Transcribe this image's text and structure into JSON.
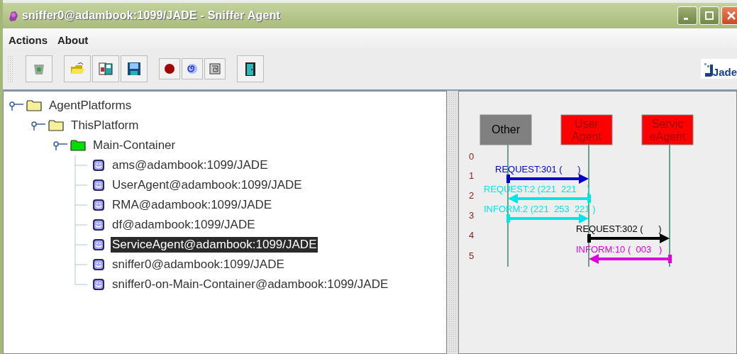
{
  "window": {
    "title": "sniffer0@adambook:1099/JADE - Sniffer Agent"
  },
  "menu": [
    "Actions",
    "About"
  ],
  "toolbar": [
    [
      {
        "kind": "trash"
      }
    ],
    [
      {
        "kind": "open-folder"
      },
      {
        "kind": "document-disk"
      },
      {
        "kind": "floppy"
      }
    ],
    [
      {
        "kind": "record"
      },
      {
        "kind": "spiral"
      },
      {
        "kind": "square-spiral"
      }
    ],
    [
      {
        "kind": "door"
      }
    ]
  ],
  "logo": "Jade",
  "tree": [
    {
      "label": "AgentPlatforms",
      "kind": "folder",
      "color": "#f5f09a",
      "expanded": true,
      "selected": false,
      "children": [
        {
          "label": "ThisPlatform",
          "kind": "folder",
          "color": "#f5f09a",
          "expanded": true,
          "selected": false,
          "children": [
            {
              "label": "Main-Container",
              "kind": "folder",
              "color": "#00dd00",
              "expanded": true,
              "selected": false,
              "children": [
                {
                  "label": "ams@adambook:1099/JADE",
                  "kind": "agent",
                  "selected": false
                },
                {
                  "label": "UserAgent@adambook:1099/JADE",
                  "kind": "agent",
                  "selected": false
                },
                {
                  "label": "RMA@adambook:1099/JADE",
                  "kind": "agent",
                  "selected": false
                },
                {
                  "label": "df@adambook:1099/JADE",
                  "kind": "agent",
                  "selected": false
                },
                {
                  "label": "ServiceAgent@adambook:1099/JADE",
                  "kind": "agent",
                  "selected": true
                },
                {
                  "label": "sniffer0@adambook:1099/JADE",
                  "kind": "agent",
                  "selected": false
                },
                {
                  "label": "sniffer0-on-Main-Container@adambook:1099/JADE",
                  "kind": "agent",
                  "selected": false
                }
              ]
            }
          ]
        }
      ]
    }
  ],
  "sequence": {
    "agents": [
      {
        "lines": [
          "Other"
        ],
        "color": "#808080"
      },
      {
        "lines": [
          "User",
          "Agent"
        ],
        "color": "#ff0000"
      },
      {
        "lines": [
          "Servic",
          "eAgent"
        ],
        "color": "#ff0000"
      }
    ],
    "rows": [
      "0",
      "1",
      "2",
      "3",
      "4",
      "5"
    ],
    "messages": [
      {
        "label": "REQUEST:301 (      )",
        "color": "#0000cc"
      },
      {
        "label": "REQUEST:2 (221  221    )",
        "color": "#00e5e5"
      },
      {
        "label": "INFORM:2 (221  253  221 )",
        "color": "#00e5e5"
      },
      {
        "label": "REQUEST:302 (      )",
        "color": "#000000"
      },
      {
        "label": "INFORM:10 (  003   )",
        "color": "#dd00dd"
      }
    ]
  }
}
